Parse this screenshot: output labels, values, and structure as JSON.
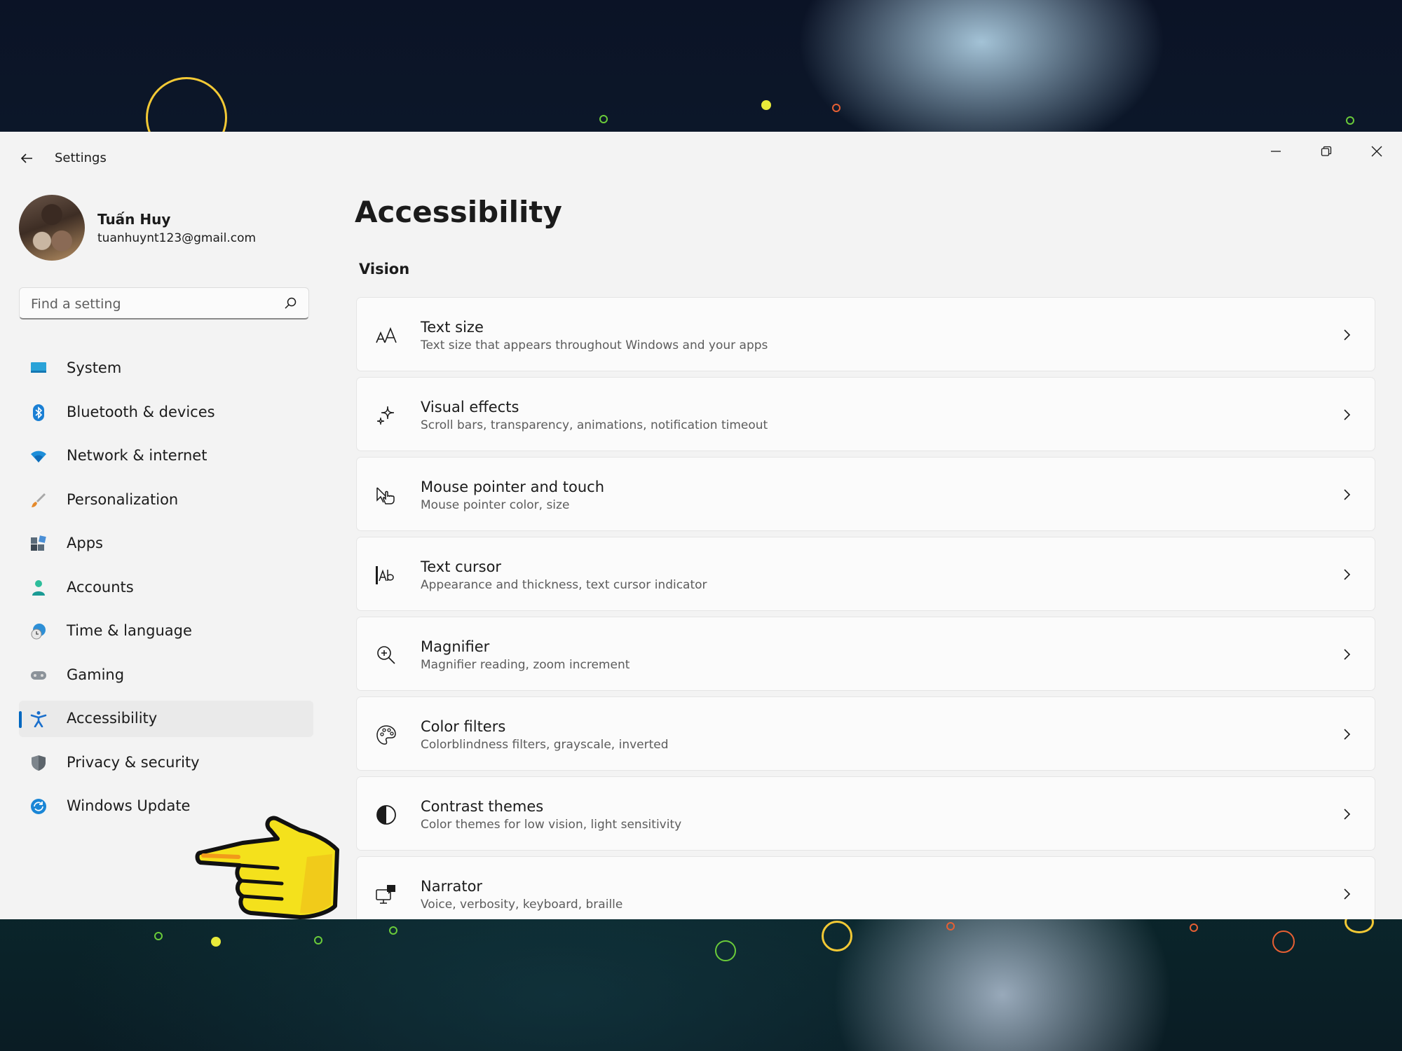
{
  "window": {
    "title": "Settings",
    "controls": [
      "minimize",
      "maximize",
      "close"
    ]
  },
  "user": {
    "name": "Tuấn Huy",
    "email": "tuanhuynt123@gmail.com"
  },
  "search": {
    "placeholder": "Find a setting",
    "value": ""
  },
  "sidebar": {
    "selected": "Accessibility",
    "items": [
      {
        "label": "System",
        "icon": "monitor-icon"
      },
      {
        "label": "Bluetooth & devices",
        "icon": "bluetooth-icon"
      },
      {
        "label": "Network & internet",
        "icon": "wifi-icon"
      },
      {
        "label": "Personalization",
        "icon": "paintbrush-icon"
      },
      {
        "label": "Apps",
        "icon": "apps-icon"
      },
      {
        "label": "Accounts",
        "icon": "person-icon"
      },
      {
        "label": "Time & language",
        "icon": "globe-clock-icon"
      },
      {
        "label": "Gaming",
        "icon": "gamepad-icon"
      },
      {
        "label": "Accessibility",
        "icon": "accessibility-icon"
      },
      {
        "label": "Privacy & security",
        "icon": "shield-icon"
      },
      {
        "label": "Windows Update",
        "icon": "refresh-icon"
      }
    ]
  },
  "main": {
    "page_title": "Accessibility",
    "section": "Vision",
    "cards": [
      {
        "title": "Text size",
        "subtitle": "Text size that appears throughout Windows and your apps",
        "icon": "text-size-icon"
      },
      {
        "title": "Visual effects",
        "subtitle": "Scroll bars, transparency, animations, notification timeout",
        "icon": "sparkle-icon"
      },
      {
        "title": "Mouse pointer and touch",
        "subtitle": "Mouse pointer color, size",
        "icon": "pointer-touch-icon"
      },
      {
        "title": "Text cursor",
        "subtitle": "Appearance and thickness, text cursor indicator",
        "icon": "text-cursor-icon"
      },
      {
        "title": "Magnifier",
        "subtitle": "Magnifier reading, zoom increment",
        "icon": "magnifier-icon"
      },
      {
        "title": "Color filters",
        "subtitle": "Colorblindness filters, grayscale, inverted",
        "icon": "palette-icon"
      },
      {
        "title": "Contrast themes",
        "subtitle": "Color themes for low vision, light sensitivity",
        "icon": "contrast-icon"
      },
      {
        "title": "Narrator",
        "subtitle": "Voice, verbosity, keyboard, braille",
        "icon": "narrator-icon"
      }
    ]
  },
  "colors": {
    "accent": "#0067c0",
    "window_bg": "#f3f3f3",
    "card_bg": "#fbfbfb",
    "pointer_hand": "#f4e11c"
  }
}
